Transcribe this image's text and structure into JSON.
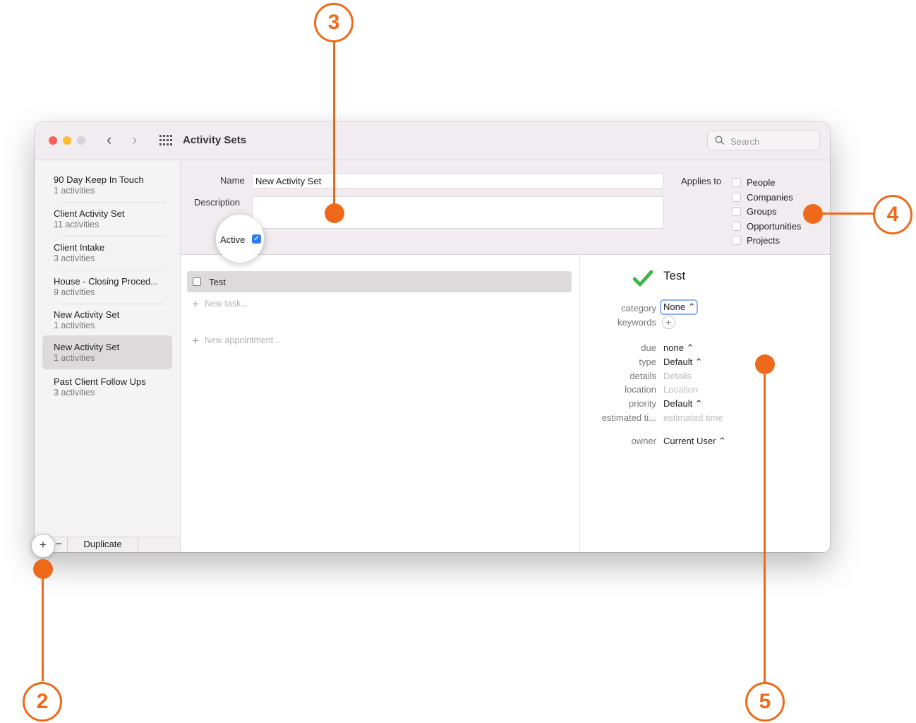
{
  "window": {
    "title": "Activity Sets",
    "search_placeholder": "Search",
    "nav_back": "‹",
    "nav_forward": "›"
  },
  "sidebar": {
    "items": [
      {
        "name": "90 Day Keep In Touch",
        "count": "1 activities"
      },
      {
        "name": "Client Activity Set",
        "count": "11 activities"
      },
      {
        "name": "Client Intake",
        "count": "3 activities"
      },
      {
        "name": "House - Closing Proced...",
        "count": "9 activities"
      },
      {
        "name": "New Activity Set",
        "count": "1 activities"
      },
      {
        "name": "New Activity Set",
        "count": "1 activities",
        "selected": true
      },
      {
        "name": "Past Client Follow Ups",
        "count": "3 activities"
      }
    ],
    "footer": {
      "add": "+",
      "remove": "−",
      "duplicate": "Duplicate"
    }
  },
  "form": {
    "name_label": "Name",
    "name_value": "New Activity Set",
    "description_label": "Description",
    "active_label": "Active",
    "active_checked": true,
    "applies_label": "Applies to",
    "applies_options": [
      "People",
      "Companies",
      "Groups",
      "Opportunities",
      "Projects"
    ]
  },
  "tasks": {
    "items": [
      {
        "title": "Test"
      }
    ],
    "new_task": "New task...",
    "new_appointment": "New appointment..."
  },
  "detail": {
    "title": "Test",
    "category_label": "category",
    "category_value": "None ⌃",
    "keywords_label": "keywords",
    "keywords_add": "+",
    "due_label": "due",
    "due_value": "none ⌃",
    "type_label": "type",
    "type_value": "Default ⌃",
    "details_label": "details",
    "details_placeholder": "Details",
    "location_label": "location",
    "location_placeholder": "Location",
    "priority_label": "priority",
    "priority_value": "Default ⌃",
    "estimated_label": "estimated ti...",
    "estimated_placeholder": "estimated time",
    "owner_label": "owner",
    "owner_value": "Current User ⌃"
  },
  "callouts": [
    "2",
    "3",
    "4",
    "5"
  ],
  "colors": {
    "callout": "#ee6a1a",
    "accent": "#2f7cf6",
    "check_green": "#3cb54a",
    "titlebar": "#f1ecef"
  }
}
